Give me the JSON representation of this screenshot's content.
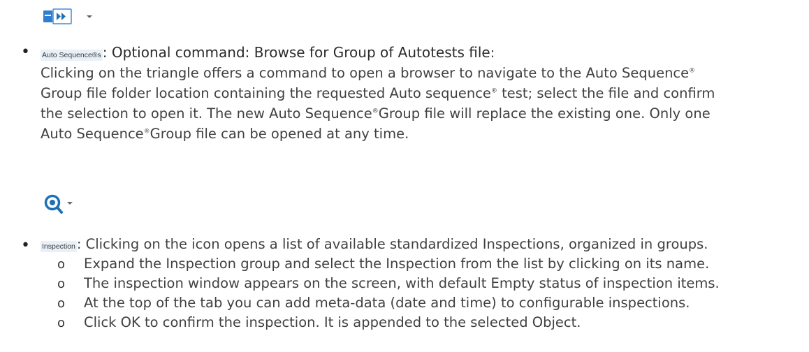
{
  "auto_sequence": {
    "button_caption": "Auto Sequence®s",
    "icon": "fast-forward-icon",
    "heading_prefix": ": Optional command: Browse for Group of Autotests file",
    "heading_suffix": ":",
    "lines": [
      [
        "Clicking on the triangle offers a command to open a browser to navigate to the Auto Sequence",
        "®",
        ""
      ],
      [
        "Group file folder location containing the requested Auto sequence",
        "®",
        " test; select the file and confirm"
      ],
      [
        "the selection to open it. The new Auto Sequence",
        "®",
        "Group file will replace the existing one. Only one"
      ],
      [
        "Auto Sequence",
        "®",
        "Group file can be opened at any time."
      ]
    ]
  },
  "inspection": {
    "button_caption": "Inspection",
    "icon": "magnifier-icon",
    "lead_text": " : Clicking on the icon opens a list of available standardized Inspections, organized in groups.",
    "sub_marker": "o",
    "sub_items": [
      "Expand the Inspection group and select the Inspection from the list by clicking on its name.",
      "The inspection window appears on the screen, with default Empty status of inspection items.",
      "At the top of the tab you can add meta-data (date and time) to configurable inspections.",
      "Click OK to confirm the inspection. It is appended to the selected Object."
    ]
  },
  "bullet_glyph": "•",
  "colors": {
    "icon_blue": "#2f7fd1",
    "icon_teal": "#1f6fb5",
    "caption_bg": "#e8f0f8"
  }
}
